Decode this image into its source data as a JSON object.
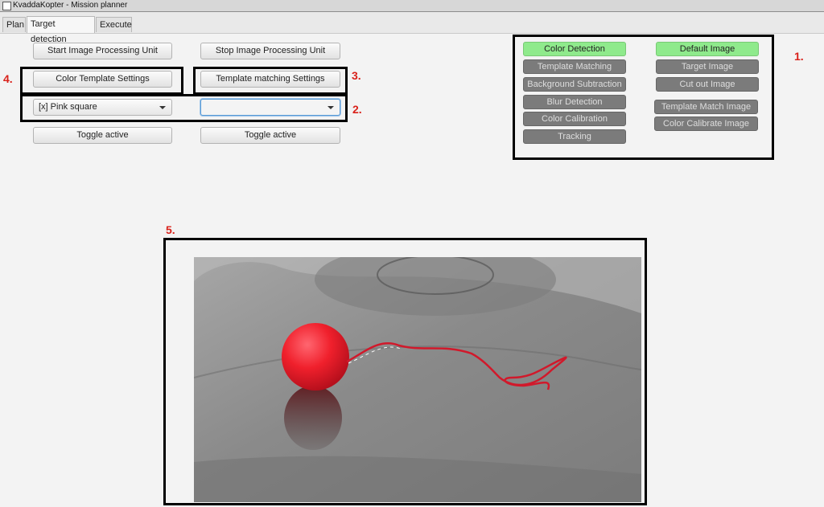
{
  "window": {
    "title": "KvaddaKopter -  Mission planner"
  },
  "tabs": [
    {
      "label": "Plan"
    },
    {
      "label": "Target detection"
    },
    {
      "label": "Execute"
    }
  ],
  "controls": {
    "start_label": "Start Image Processing Unit",
    "stop_label": "Stop Image Processing Unit",
    "color_template_label": "Color Template Settings",
    "template_matching_label": "Template matching Settings",
    "color_select_value": "[x] Pink square",
    "template_select_value": "",
    "toggle_left_label": "Toggle active",
    "toggle_right_label": "Toggle active"
  },
  "detection_modes": [
    {
      "label": "Color Detection",
      "active": true
    },
    {
      "label": "Template Matching",
      "active": false
    },
    {
      "label": "Background Subtraction",
      "active": false
    },
    {
      "label": "Blur Detection",
      "active": false
    },
    {
      "label": "Color Calibration",
      "active": false
    },
    {
      "label": "Tracking",
      "active": false
    }
  ],
  "image_modes": [
    {
      "label": "Default Image",
      "active": true
    },
    {
      "label": "Target Image",
      "active": false
    },
    {
      "label": "Cut out Image",
      "active": false
    },
    {
      "label": "Template Match Image",
      "active": false
    },
    {
      "label": "Color Calibrate Image",
      "active": false
    }
  ],
  "annotations": {
    "n1": "1.",
    "n2": "2.",
    "n3": "3.",
    "n4": "4.",
    "n5": "5."
  },
  "colors": {
    "active_mode": "#8fea8c",
    "inactive_mode": "#7b7b7b",
    "annotation_number": "#d9211a",
    "balloon": "#f0202c"
  },
  "icons": {
    "app": "app-icon",
    "dropdown": "chevron-down-icon"
  }
}
